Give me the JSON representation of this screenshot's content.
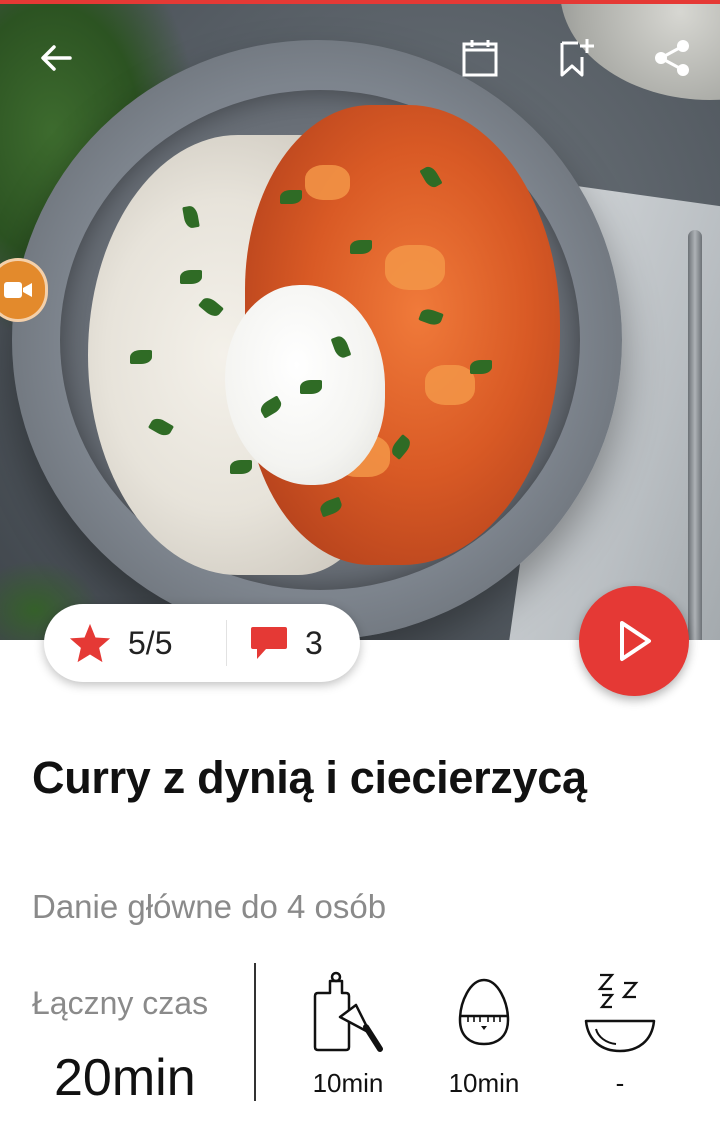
{
  "rating": {
    "score": "5/5",
    "comments": "3"
  },
  "recipe": {
    "title": "Curry z dynią i ciecierzycą",
    "subtitle": "Danie główne do 4 osób"
  },
  "time": {
    "total_label": "Łączny czas",
    "total_value": "20min",
    "steps": [
      {
        "icon": "cutting-board-knife-icon",
        "value": "10min"
      },
      {
        "icon": "egg-timer-icon",
        "value": "10min"
      },
      {
        "icon": "resting-bowl-icon",
        "value": "-"
      }
    ]
  },
  "colors": {
    "accent": "#e53935",
    "muted_text": "#8a8a8a",
    "video_badge": "#e38a2c"
  }
}
